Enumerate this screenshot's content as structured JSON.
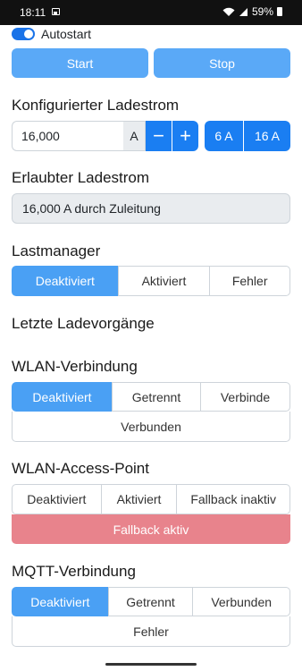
{
  "status_bar": {
    "time": "18:11",
    "battery": "59%"
  },
  "autostart": {
    "label": "Autostart",
    "on": true
  },
  "buttons": {
    "start": "Start",
    "stop": "Stop"
  },
  "configured_current": {
    "heading": "Konfigurierter Ladestrom",
    "value": "16,000",
    "unit": "A",
    "minus": "−",
    "plus": "+",
    "preset_6": "6 A",
    "preset_16": "16 A"
  },
  "allowed_current": {
    "heading": "Erlaubter Ladestrom",
    "value": "16,000 A durch Zuleitung"
  },
  "load_manager": {
    "heading": "Lastmanager",
    "options": [
      "Deaktiviert",
      "Aktiviert",
      "Fehler"
    ],
    "active": 0
  },
  "last_charges": {
    "heading": "Letzte Ladevorgänge"
  },
  "wlan_connection": {
    "heading": "WLAN-Verbindung",
    "options": [
      "Deaktiviert",
      "Getrennt",
      "Verbinde"
    ],
    "extra": "Verbunden",
    "active": 0
  },
  "wlan_ap": {
    "heading": "WLAN-Access-Point",
    "options": [
      "Deaktiviert",
      "Aktiviert",
      "Fallback inaktiv"
    ],
    "extra": "Fallback aktiv"
  },
  "mqtt": {
    "heading": "MQTT-Verbindung",
    "options": [
      "Deaktiviert",
      "Getrennt",
      "Verbunden"
    ],
    "extra": "Fehler",
    "active": 0
  },
  "colors": {
    "primary": "#1a7ef2",
    "primary_light": "#4aa0f4",
    "danger_light": "#e8838c"
  }
}
